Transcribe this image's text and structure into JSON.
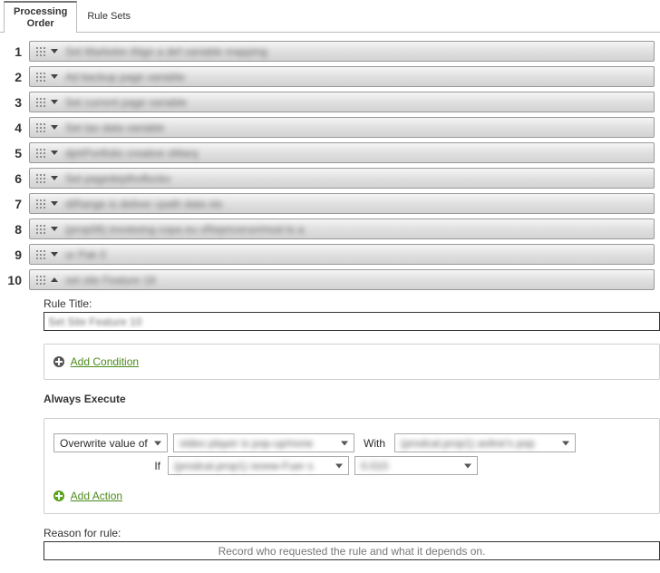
{
  "tabs": {
    "processing_order": "Processing\nOrder",
    "rule_sets": "Rule Sets"
  },
  "rules": [
    {
      "order": 1,
      "title": "Set Marketer Align a def variable mapping",
      "expanded": false
    },
    {
      "order": 2,
      "title": "Ad backup page variable",
      "expanded": false
    },
    {
      "order": 3,
      "title": "Set current page variable",
      "expanded": false
    },
    {
      "order": 4,
      "title": "Set tax data variable",
      "expanded": false
    },
    {
      "order": 5,
      "title": "dphPortfolio creative sMarq",
      "expanded": false
    },
    {
      "order": 6,
      "title": "Set pagedepthoflocko",
      "expanded": false
    },
    {
      "order": 7,
      "title": "diRange is deliver cpath data sts",
      "expanded": false
    },
    {
      "order": 8,
      "title": "(prop06) invokeing copa eu vRepricerun/mod to a",
      "expanded": false
    },
    {
      "order": 9,
      "title": "ur Pak 0",
      "expanded": false
    },
    {
      "order": 10,
      "title": "set site Feature 18",
      "expanded": true
    }
  ],
  "expanded": {
    "rule_title_label": "Rule Title:",
    "rule_title_value": "Set Site Feature 10",
    "add_condition": "Add Condition",
    "always_execute": "Always Execute",
    "action_type": "Overwrite value of",
    "action_target": "video player is pop-up/none",
    "with_label": "With",
    "with_value": "(prodcal.prop1) avline's pop",
    "if_label": "If",
    "if_field": "(prodcal.prop1) isnew-Fuer s",
    "if_value": "0.010",
    "add_action": "Add Action",
    "reason_label": "Reason for rule:",
    "reason_placeholder": "Record who requested the rule and what it depends on."
  }
}
